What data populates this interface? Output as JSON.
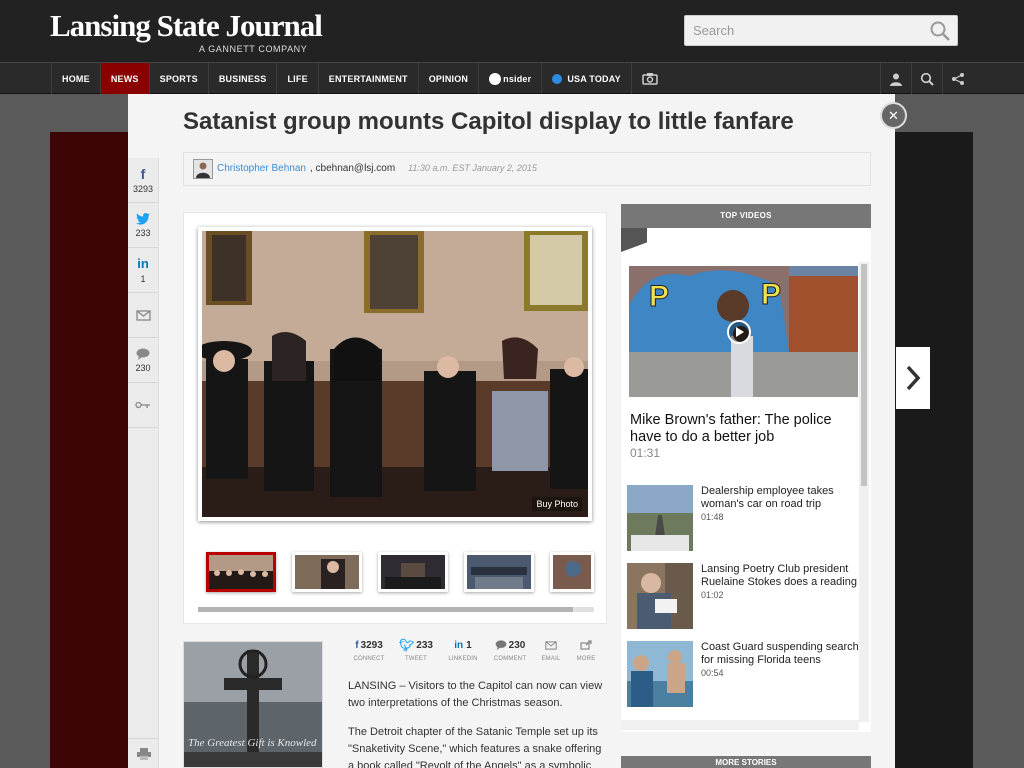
{
  "header": {
    "logo": "Lansing State Journal",
    "logo_sub": "A GANNETT COMPANY",
    "search_placeholder": "Search"
  },
  "nav": {
    "items": [
      "HOME",
      "NEWS",
      "SPORTS",
      "BUSINESS",
      "LIFE",
      "ENTERTAINMENT",
      "OPINION",
      "nsider",
      "USA TODAY"
    ],
    "active": "NEWS"
  },
  "article": {
    "title": "Satanist group mounts Capitol display to little fanfare",
    "author": "Christopher Behnan",
    "email": ", cbehnan@lsj.com",
    "datetime": "11:30 a.m. EST January 2, 2015",
    "buy_photo": "Buy Photo",
    "paragraph1": "LANSING – Visitors to the Capitol can now can view two interpretations of the Christmas season.",
    "paragraph2": "The Detroit chapter of the Satanic Temple set up its \"Snaketivity Scene,\" which features a snake offering a book called \"Revolt of the Angels\" as a symbolic",
    "image_caption_text": "The Greatest Gift is Knowled"
  },
  "share_rail": {
    "facebook": "3293",
    "twitter": "233",
    "linkedin": "1",
    "comments": "230"
  },
  "share_bar": [
    {
      "count": "3293",
      "label": "CONNECT",
      "icon": "facebook-icon"
    },
    {
      "count": "233",
      "label": "TWEET",
      "icon": "twitter-icon"
    },
    {
      "count": "1",
      "label": "LINKEDIN",
      "icon": "linkedin-icon"
    },
    {
      "count": "230",
      "label": "COMMENT",
      "icon": "comment-icon"
    },
    {
      "count": "",
      "label": "EMAIL",
      "icon": "email-icon"
    },
    {
      "count": "",
      "label": "MORE",
      "icon": "share-icon"
    }
  ],
  "sidebar": {
    "header": "TOP VIDEOS",
    "featured": {
      "title": "Mike Brown's father: The police have to do a better job",
      "duration": "01:31",
      "badge": "USA TODAY"
    },
    "videos": [
      {
        "title": "Dealership employee takes woman's car on road trip",
        "duration": "01:48"
      },
      {
        "title": "Lansing Poetry Club president Ruelaine Stokes does a reading",
        "duration": "01:02"
      },
      {
        "title": "Coast Guard suspending search for missing Florida teens",
        "duration": "00:54"
      }
    ],
    "more_header": "MORE STORIES"
  },
  "colors": {
    "accent_red": "#8a0000",
    "link_blue": "#3a8ed6"
  }
}
